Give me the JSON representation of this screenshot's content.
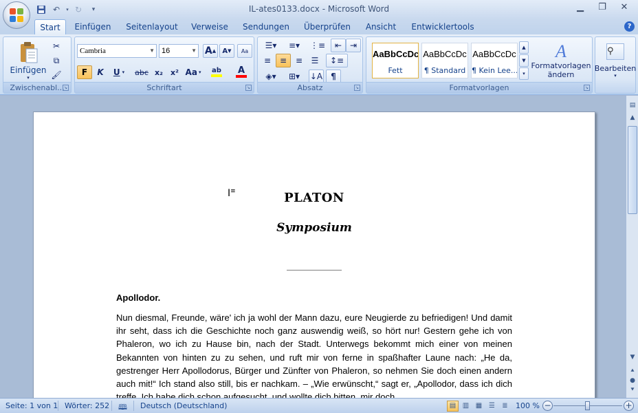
{
  "window": {
    "title": "IL-ates0133.docx - Microsoft Word"
  },
  "tabs": [
    "Start",
    "Einfügen",
    "Seitenlayout",
    "Verweise",
    "Sendungen",
    "Überprüfen",
    "Ansicht",
    "Entwicklertools"
  ],
  "ribbon": {
    "clipboard": {
      "paste_label": "Einfügen",
      "group_label": "Zwischenabl..."
    },
    "font": {
      "name": "Cambria",
      "size": "16",
      "group_label": "Schriftart",
      "bold": "F",
      "italic": "K",
      "underline": "U",
      "strike": "abc",
      "subscript": "x₂",
      "superscript": "x²",
      "case": "Aa",
      "color_letter": "A",
      "grow_letter": "A",
      "shrink_letter": "A",
      "highlight_label": "ab",
      "highlight_color": "#ffff00",
      "font_color": "#ff0000"
    },
    "paragraph": {
      "group_label": "Absatz",
      "show_marks": "¶"
    },
    "styles": {
      "group_label": "Formatvorlagen",
      "items": [
        {
          "sample": "AaBbCcDc",
          "name": "Fett"
        },
        {
          "sample": "AaBbCcDc",
          "name": "¶ Standard"
        },
        {
          "sample": "AaBbCcDc",
          "name": "¶ Kein Lee..."
        }
      ],
      "change_label_1": "Formatvorlagen",
      "change_label_2": "ändern"
    },
    "editing": {
      "label": "Bearbeiten"
    }
  },
  "document": {
    "title": "PLATON",
    "subtitle": "Symposium",
    "speaker": "Apollodor.",
    "paragraph": "Nun diesmal, Freunde, wäre' ich ja wohl der Mann dazu, eure Neugierde zu befriedigen! Und damit ihr seht, dass ich die Geschichte noch ganz auswendig weiß, so hört nur! Gestern gehe ich von Phaleron, wo ich zu Hause bin, nach der Stadt. Unterwegs bekommt mich einer von meinen Bekannten von hinten zu zu sehen, und ruft mir von ferne in spaßhafter Laune nach: „He da, gestrenger Herr Apollodorus, Bürger und Zünfter von Phaleron, so nehmen Sie doch einen andern auch mit!“ Ich stand also still, bis er nachkam. – „Wie erwünscht,“ sagt er, „Apollodor, dass ich dich treffe. Ich habe dich schon aufgesucht, und wollte dich bitten, mir doch"
  },
  "status": {
    "page": "Seite: 1 von 1",
    "words": "Wörter: 252",
    "language": "Deutsch (Deutschland)",
    "zoom": "100 %",
    "zoom_level": 0.5
  },
  "colors": {
    "accent": "#15428b",
    "ribbon_bg": "#dbe7f6",
    "workspace_bg": "#a9bcd6"
  }
}
